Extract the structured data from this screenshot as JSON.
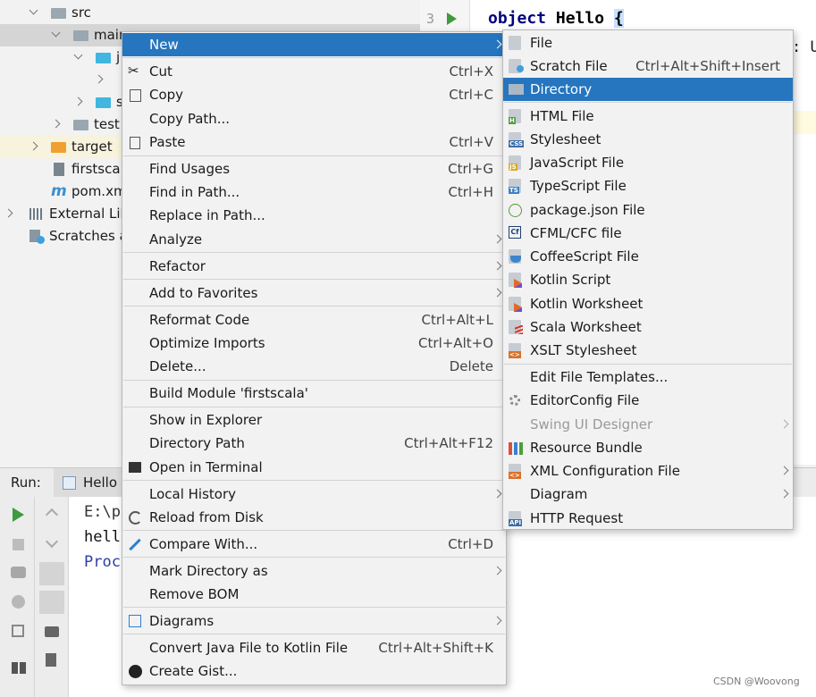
{
  "tree": {
    "rows": [
      {
        "label": "src"
      },
      {
        "label": "main"
      },
      {
        "label": "j"
      },
      {
        "label": ""
      },
      {
        "label": "s"
      },
      {
        "label": "test"
      },
      {
        "label": "target"
      },
      {
        "label": "firstscala"
      },
      {
        "label": "pom.xml"
      },
      {
        "label": "External Lib"
      },
      {
        "label": "Scratches a"
      }
    ]
  },
  "editor": {
    "line_number": "3",
    "code_keyword": "object",
    "code_name": "Hello",
    "code_brace": "{",
    "code_second": ": U"
  },
  "run": {
    "label": "Run:",
    "tab": "Hello",
    "console_lines": [
      "E:\\p",
      "hell",
      "Proc"
    ]
  },
  "context_menu": {
    "items": [
      {
        "label": "New",
        "shortcut": "",
        "submenu": true
      },
      {
        "label": "Cut",
        "shortcut": "Ctrl+X"
      },
      {
        "label": "Copy",
        "shortcut": "Ctrl+C"
      },
      {
        "label": "Copy Path...",
        "shortcut": ""
      },
      {
        "label": "Paste",
        "shortcut": "Ctrl+V"
      },
      {
        "label": "Find Usages",
        "shortcut": "Ctrl+G"
      },
      {
        "label": "Find in Path...",
        "shortcut": "Ctrl+H"
      },
      {
        "label": "Replace in Path...",
        "shortcut": ""
      },
      {
        "label": "Analyze",
        "shortcut": "",
        "submenu": true
      },
      {
        "label": "Refactor",
        "shortcut": "",
        "submenu": true
      },
      {
        "label": "Add to Favorites",
        "shortcut": "",
        "submenu": true
      },
      {
        "label": "Reformat Code",
        "shortcut": "Ctrl+Alt+L"
      },
      {
        "label": "Optimize Imports",
        "shortcut": "Ctrl+Alt+O"
      },
      {
        "label": "Delete...",
        "shortcut": "Delete"
      },
      {
        "label": "Build Module 'firstscala'",
        "shortcut": ""
      },
      {
        "label": "Show in Explorer",
        "shortcut": ""
      },
      {
        "label": "Directory Path",
        "shortcut": "Ctrl+Alt+F12"
      },
      {
        "label": "Open in Terminal",
        "shortcut": ""
      },
      {
        "label": "Local History",
        "shortcut": "",
        "submenu": true
      },
      {
        "label": "Reload from Disk",
        "shortcut": ""
      },
      {
        "label": "Compare With...",
        "shortcut": "Ctrl+D"
      },
      {
        "label": "Mark Directory as",
        "shortcut": "",
        "submenu": true
      },
      {
        "label": "Remove BOM",
        "shortcut": ""
      },
      {
        "label": "Diagrams",
        "shortcut": "",
        "submenu": true
      },
      {
        "label": "Convert Java File to Kotlin File",
        "shortcut": "Ctrl+Alt+Shift+K"
      },
      {
        "label": "Create Gist...",
        "shortcut": ""
      }
    ]
  },
  "new_submenu": {
    "items": [
      {
        "label": "File",
        "shortcut": ""
      },
      {
        "label": "Scratch File",
        "shortcut": "Ctrl+Alt+Shift+Insert"
      },
      {
        "label": "Directory",
        "shortcut": ""
      },
      {
        "label": "HTML File"
      },
      {
        "label": "Stylesheet"
      },
      {
        "label": "JavaScript File"
      },
      {
        "label": "TypeScript File"
      },
      {
        "label": "package.json File"
      },
      {
        "label": "CFML/CFC file"
      },
      {
        "label": "CoffeeScript File"
      },
      {
        "label": "Kotlin Script"
      },
      {
        "label": "Kotlin Worksheet"
      },
      {
        "label": "Scala Worksheet"
      },
      {
        "label": "XSLT Stylesheet"
      },
      {
        "label": "Edit File Templates..."
      },
      {
        "label": "EditorConfig File"
      },
      {
        "label": "Swing UI Designer"
      },
      {
        "label": "Resource Bundle"
      },
      {
        "label": "XML Configuration File"
      },
      {
        "label": "Diagram"
      },
      {
        "label": "HTTP Request"
      }
    ],
    "icon_tags": {
      "html": "H",
      "css": "CSS",
      "js": "JS",
      "ts": "TS",
      "cf": "Cf",
      "api": "API"
    }
  },
  "watermark": "CSDN @Woovong",
  "colors": {
    "selection": "#2675bf",
    "menu_bg": "#f2f2f2",
    "keyword": "#000080"
  }
}
